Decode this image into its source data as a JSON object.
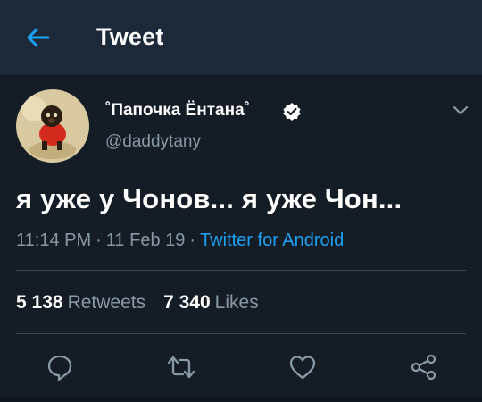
{
  "header": {
    "back_icon": "arrow-left-icon",
    "title": "Tweet"
  },
  "tweet": {
    "display_name": "˚Папочка Ёнтана˚",
    "verified_icon": "verified-badge-icon",
    "handle": "@daddytany",
    "more_icon": "chevron-down-icon",
    "text": "я уже у Чонов... я уже Чон...",
    "time": "11:14 PM",
    "separator": "·",
    "date": "11 Feb 19",
    "source": "Twitter for Android",
    "retweets_count": "5 138",
    "retweets_label": "Retweets",
    "likes_count": "7 340",
    "likes_label": "Likes"
  },
  "actions": {
    "reply_icon": "reply-icon",
    "retweet_icon": "retweet-icon",
    "like_icon": "heart-icon",
    "share_icon": "share-icon"
  },
  "colors": {
    "background": "#141d26",
    "header": "#1c2938",
    "accent": "#1da1f2",
    "secondary_text": "#8899a6",
    "divider": "#38444d"
  }
}
